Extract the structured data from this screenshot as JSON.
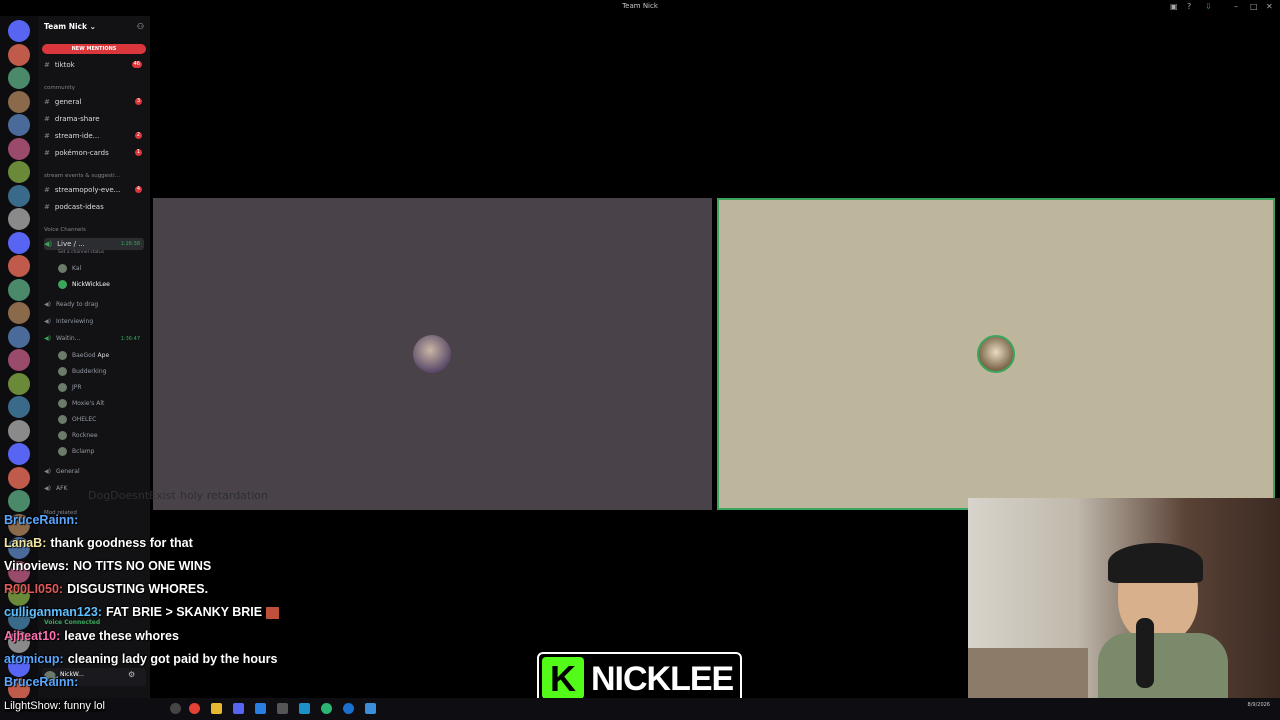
{
  "window": {
    "title": "Team Nick"
  },
  "server": {
    "name": "Team Nick",
    "new_mentions": "NEW MENTIONS",
    "channels": [
      {
        "name": "tiktok",
        "count": "46"
      },
      {
        "name": "general",
        "count": "3"
      },
      {
        "name": "drama-share",
        "count": ""
      },
      {
        "name": "stream-ide...",
        "count": "2"
      },
      {
        "name": "pokémon-cards",
        "count": "1"
      },
      {
        "name": "streamopoly-eve...",
        "count": "4"
      },
      {
        "name": "podcast-ideas",
        "count": ""
      }
    ],
    "categories": {
      "community": "community",
      "stream_events": "stream events & suggesti...",
      "voice": "Voice Channels",
      "mod": "Mod related"
    },
    "voice": {
      "live_name": "Live / ...",
      "live_timer": "1:26:38",
      "live_status": "Set a channel status",
      "live_users": [
        "Kal",
        "NickWickLee"
      ],
      "ready_to_drag": "Ready to drag",
      "interviewing": "Interviewing",
      "waiting_name": "Waitin...",
      "waiting_timer": "1:36:47",
      "waiting_users": [
        "BaeGod",
        "Budderking",
        "JPR",
        "Moxie's Alt",
        "OHELEC",
        "Rocknee",
        "Bclamp"
      ],
      "waiting_tag": "Ape",
      "general": "General",
      "afk": "AFK"
    },
    "voice_connected": "Voice Connected",
    "user_name": "NickW..."
  },
  "stage": {
    "faded_user": "DogDoesntExist",
    "faded_text": "holy retardation"
  },
  "chat": [
    {
      "user": "BruceRainn:",
      "text": "",
      "color": "#5aa7ff"
    },
    {
      "user": "LanaB:",
      "text": "thank goodness for that",
      "color": "#f0e6a0"
    },
    {
      "user": "Vinoviews:",
      "text": "NO TITS NO ONE WINS",
      "color": "#ffffff"
    },
    {
      "user": "R00LI050:",
      "text": "DISGUSTING WHORES.",
      "color": "#e05a5a"
    },
    {
      "user": "culliganman123:",
      "text": "FAT BRIE > SKANKY BRIE",
      "color": "#60c0ff"
    },
    {
      "user": "Ajheat10:",
      "text": "leave these whores",
      "color": "#ff6fb0"
    },
    {
      "user": "atomicup:",
      "text": "cleaning lady got paid by the hours",
      "color": "#5aa7ff"
    },
    {
      "user": "BruceRainn:",
      "text": "",
      "color": "#5aa7ff"
    }
  ],
  "ticker": {
    "text": "LilghtShow: funny lol"
  },
  "logo": {
    "letter": "K",
    "name": "NICKLEE"
  },
  "taskbar": {
    "time": "",
    "date": "8/9/2026"
  },
  "colors": {
    "kick_green": "#53fc18",
    "discord_red": "#da373c",
    "speaking_green": "#3ba55c"
  }
}
